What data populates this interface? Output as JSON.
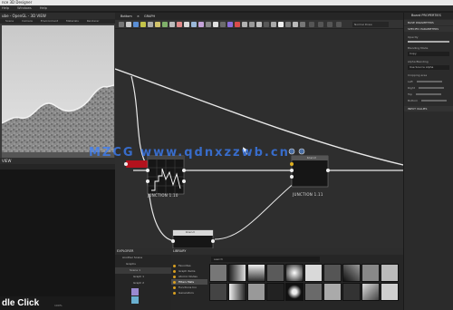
{
  "app": {
    "title": "nce 3D Designer",
    "menu": [
      "Help",
      "Windows",
      "Help"
    ]
  },
  "view3d": {
    "title": "ube - OpenGL - 3D VIEW",
    "toolbar": [
      "Scene",
      "Camera",
      "Environment",
      "Materials",
      "Renderer"
    ]
  },
  "view2d": {
    "title": "VIEW",
    "caption": "dle Click",
    "stats": "100%"
  },
  "graph": {
    "tab": "Bottom",
    "tab_close": "×",
    "tab_icon": "GRAPH",
    "mode_select": "Normal Draw",
    "node_bitmap_label": "JUNCTION  1.10",
    "node_right_label": "JUNCTION  1.11",
    "node_bottom_title": "blend",
    "node_right_title": "blend",
    "watermark": "MZCG  www.qdnxzzwb.cn"
  },
  "explorer": {
    "title": "EXPLORER",
    "rows": [
      "Another Scene",
      "Graphs",
      "Scene 1",
      "Graph 1",
      "Graph 2"
    ]
  },
  "library": {
    "title": "LIBRARY",
    "search_placeholder": "search",
    "categories": [
      "Favorites",
      "Graph items",
      "Atomic Nodes",
      "Filters Mats",
      "Functions Ino",
      "Generators"
    ]
  },
  "properties": {
    "title": "Board  PROPERTIES",
    "section1": "BASE PARAMETERS",
    "section2": "SPECIFIC PARAMETERS",
    "opacity_label": "Opacity",
    "blending_label": "Blending Mode",
    "blending_value": "Copy",
    "alpha_label": "Alpha Blending",
    "alpha_value": "Use Source Alpha",
    "cropping_label": "Cropping area",
    "crop_rows": [
      "Left",
      "Right",
      "Top",
      "Bottom"
    ],
    "input_section": "INPUT VALUES"
  },
  "colors": {
    "accent_red": "#b3121d",
    "wire": "#e8e8e8",
    "watermark": "#3c82ff"
  }
}
